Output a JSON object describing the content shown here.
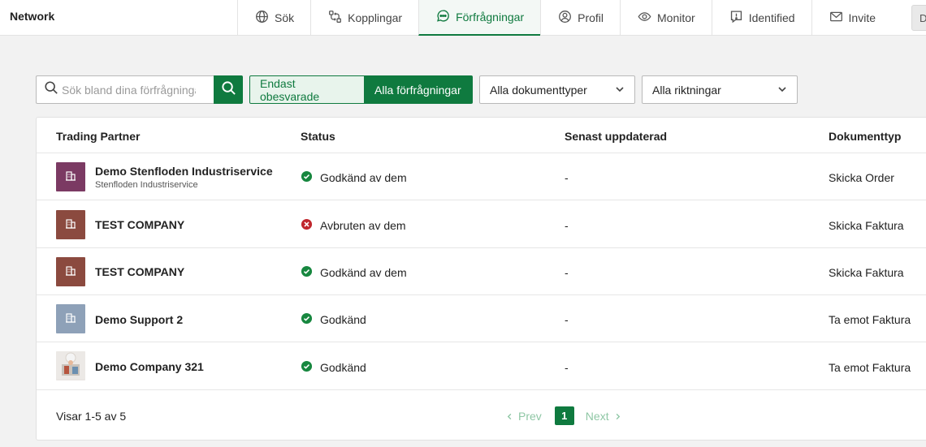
{
  "app": {
    "title": "Network"
  },
  "nav": {
    "items": [
      {
        "label": "Sök",
        "icon": "globe-icon"
      },
      {
        "label": "Kopplingar",
        "icon": "connections-icon"
      },
      {
        "label": "Förfrågningar",
        "icon": "chat-icon",
        "active": true
      },
      {
        "label": "Profil",
        "icon": "user-circle-icon"
      },
      {
        "label": "Monitor",
        "icon": "eye-icon"
      },
      {
        "label": "Identified",
        "icon": "alert-square-icon"
      },
      {
        "label": "Invite",
        "icon": "mail-icon"
      }
    ],
    "end_label": "D"
  },
  "filters": {
    "search_placeholder": "Sök bland dina förfrågningar",
    "toggle_unanswered": "Endast obesvarade",
    "toggle_all": "Alla förfrågningar",
    "doc_type": "Alla dokumenttyper",
    "direction": "Alla riktningar"
  },
  "table": {
    "headers": [
      "Trading Partner",
      "Status",
      "Senast uppdaterad",
      "Dokumenttyp"
    ],
    "rows": [
      {
        "name": "Demo Stenfloden Industriservice",
        "sub": "Stenfloden Industriservice",
        "status": "Godkänd av dem",
        "status_kind": "ok",
        "updated": "-",
        "doctype": "Skicka Order",
        "logo_color": "#7b3a63"
      },
      {
        "name": "TEST COMPANY",
        "sub": "",
        "status": "Avbruten av dem",
        "status_kind": "error",
        "updated": "-",
        "doctype": "Skicka Faktura",
        "logo_color": "#8b4a3f"
      },
      {
        "name": "TEST COMPANY",
        "sub": "",
        "status": "Godkänd av dem",
        "status_kind": "ok",
        "updated": "-",
        "doctype": "Skicka Faktura",
        "logo_color": "#8b4a3f"
      },
      {
        "name": "Demo Support 2",
        "sub": "",
        "status": "Godkänd",
        "status_kind": "ok",
        "updated": "-",
        "doctype": "Ta emot Faktura",
        "logo_color": "#8ea1b8"
      },
      {
        "name": "Demo Company 321",
        "sub": "",
        "status": "Godkänd",
        "status_kind": "ok",
        "updated": "-",
        "doctype": "Ta emot Faktura",
        "logo_color": "photo"
      }
    ]
  },
  "pagination": {
    "summary": "Visar 1-5 av 5",
    "prev": "Prev",
    "next": "Next",
    "current_page": "1"
  },
  "colors": {
    "accent": "#0f7a3f",
    "status_ok": "#17873f",
    "status_error": "#c0272d"
  }
}
